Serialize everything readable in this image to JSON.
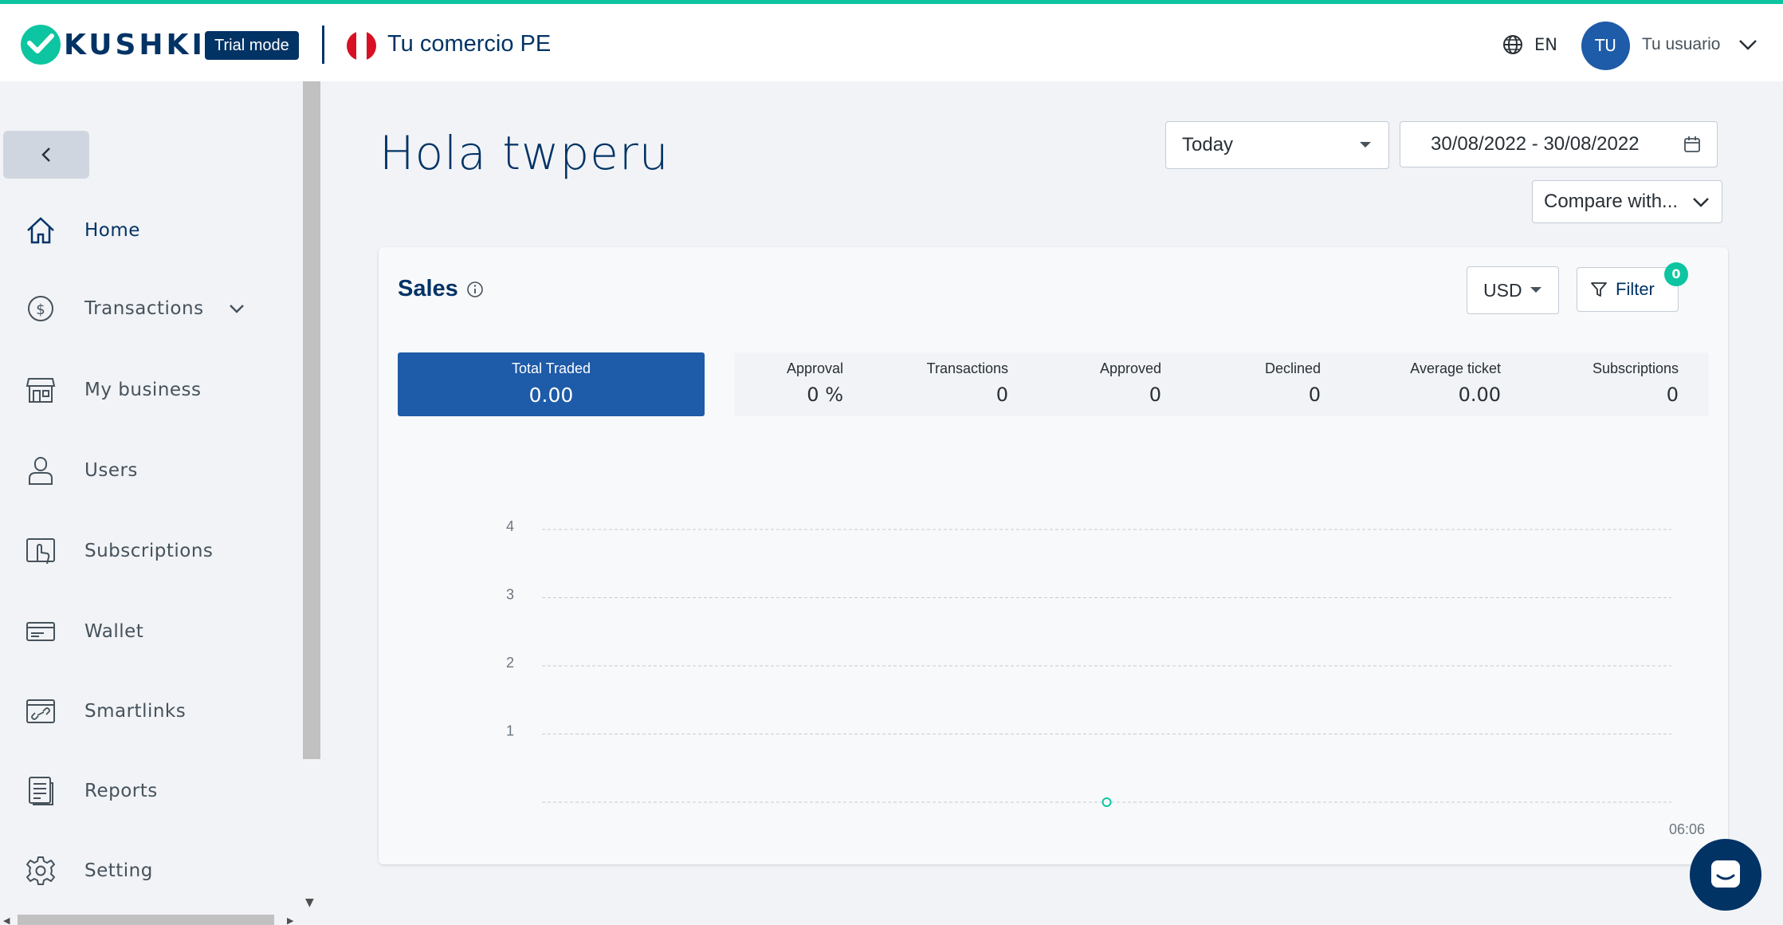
{
  "header": {
    "brand": "KUSHKI",
    "trial_badge": "Trial mode",
    "merchant_name": "Tu comercio PE",
    "language": "EN",
    "avatar_initials": "TU",
    "username": "Tu usuario",
    "flag_colors": [
      "#d91023",
      "#ffffff",
      "#d91023"
    ]
  },
  "sidebar": {
    "items": [
      {
        "label": "Home",
        "icon": "home-icon"
      },
      {
        "label": "Transactions",
        "icon": "dollar-coin-icon"
      },
      {
        "label": "My business",
        "icon": "store-icon"
      },
      {
        "label": "Users",
        "icon": "user-icon"
      },
      {
        "label": "Subscriptions",
        "icon": "touch-tap-icon"
      },
      {
        "label": "Wallet",
        "icon": "card-icon"
      },
      {
        "label": "Smartlinks",
        "icon": "link-card-icon"
      },
      {
        "label": "Reports",
        "icon": "report-icon"
      },
      {
        "label": "Setting",
        "icon": "gear-icon"
      }
    ]
  },
  "main": {
    "greeting": "Hola twperu",
    "period_select": "Today",
    "date_range": "30/08/2022 - 30/08/2022",
    "compare_select": "Compare with..."
  },
  "sales": {
    "title": "Sales",
    "currency": "USD",
    "filter_label": "Filter",
    "filter_count": "0",
    "total_traded": {
      "label": "Total Traded",
      "value": "0.00"
    },
    "kpis": [
      {
        "label": "Approval",
        "value": "0 %"
      },
      {
        "label": "Transactions",
        "value": "0"
      },
      {
        "label": "Approved",
        "value": "0"
      },
      {
        "label": "Declined",
        "value": "0"
      },
      {
        "label": "Average ticket",
        "value": "0.00"
      },
      {
        "label": "Subscriptions",
        "value": "0"
      }
    ]
  },
  "chart_data": {
    "type": "line",
    "x": [
      "06:06"
    ],
    "y_ticks": [
      "1",
      "2",
      "3",
      "4"
    ],
    "series": [
      {
        "values": [
          0
        ]
      }
    ],
    "ylim": [
      0,
      4
    ],
    "grid": true,
    "line_color": "#0dc5a0"
  },
  "colors": {
    "accent": "#0dc5a0",
    "brand_navy": "#023365",
    "primary_blue": "#1e5ba8"
  }
}
